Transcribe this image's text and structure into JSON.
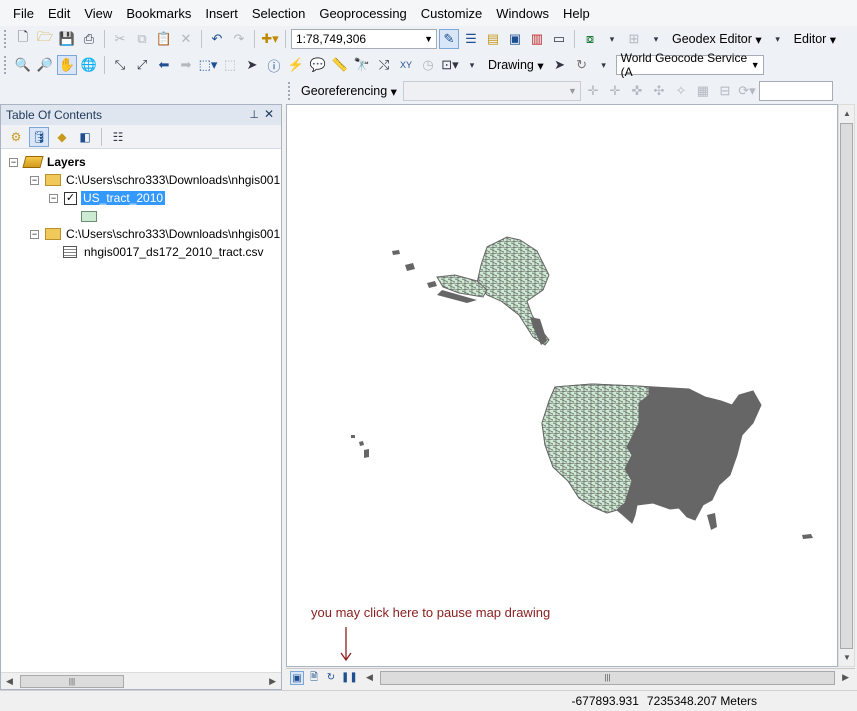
{
  "menu": [
    "File",
    "Edit",
    "View",
    "Bookmarks",
    "Insert",
    "Selection",
    "Geoprocessing",
    "Customize",
    "Windows",
    "Help"
  ],
  "standard_toolbar": {
    "scale": "1:78,749,306",
    "geodex_label": "Geodex Editor",
    "editor_label": "Editor"
  },
  "tools_toolbar": {
    "drawing_label": "Drawing",
    "geocode_service": "World Geocode Service (A"
  },
  "georef_toolbar": {
    "label": "Georeferencing",
    "layer_combo": ""
  },
  "toc": {
    "title": "Table Of Contents",
    "root": "Layers",
    "folder1": "C:\\Users\\schro333\\Downloads\\nhgis001",
    "layer": "US_tract_2010",
    "layer_checked": true,
    "layer_fill": "#cdebd3",
    "folder2": "C:\\Users\\schro333\\Downloads\\nhgis001",
    "table": "nhgis0017_ds172_2010_tract.csv"
  },
  "map": {
    "annotation": "you may click here to pause map drawing",
    "annotation_color": "#8b2020",
    "feature_fill": "#cdebd3",
    "outline_color": "#666666"
  },
  "status": {
    "x": "-677893.931",
    "y": "7235348.207 Meters"
  }
}
